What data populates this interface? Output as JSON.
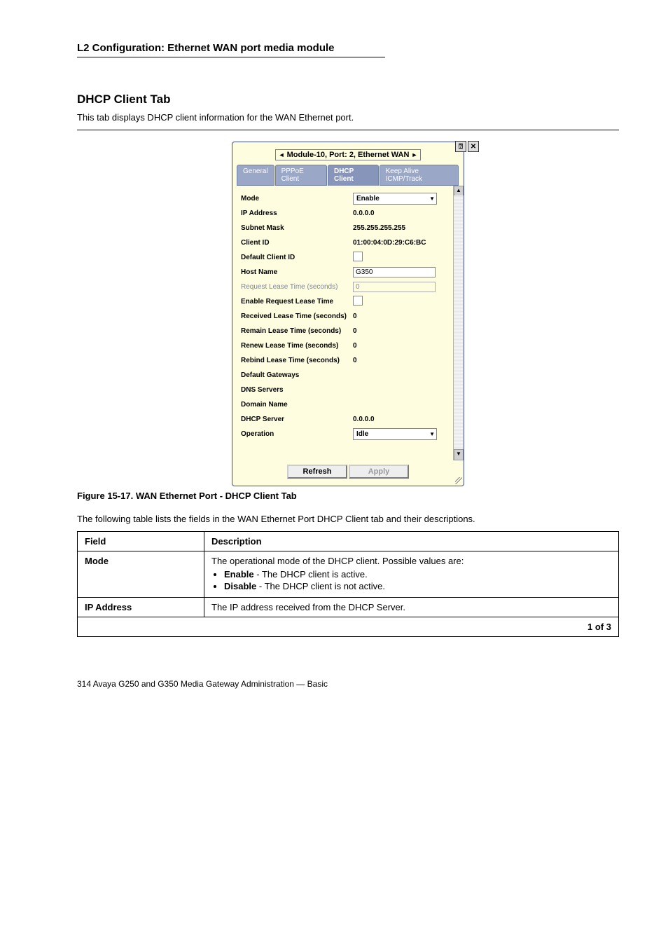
{
  "breadcrumb": "L2 Configuration: Ethernet WAN port media module",
  "section": {
    "title": "DHCP Client Tab",
    "desc": "This tab displays DHCP client information for the WAN Ethernet port."
  },
  "dialog": {
    "title_prefix_arrow": "◄",
    "title": "Module-10, Port: 2, Ethernet WAN",
    "title_suffix_arrow": "►",
    "tabs": [
      {
        "label": "General",
        "active": false
      },
      {
        "label": "PPPoE Client",
        "active": false
      },
      {
        "label": "DHCP Client",
        "active": true
      },
      {
        "label": "Keep Alive ICMP/Track",
        "active": false
      }
    ],
    "rows": [
      {
        "key": "mode",
        "label": "Mode",
        "control": "select",
        "value": "Enable"
      },
      {
        "key": "ip_address",
        "label": "IP Address",
        "control": "text",
        "value": "0.0.0.0"
      },
      {
        "key": "subnet_mask",
        "label": "Subnet Mask",
        "control": "text",
        "value": "255.255.255.255"
      },
      {
        "key": "client_id",
        "label": "Client ID",
        "control": "text",
        "value": "01:00:04:0D:29:C6:BC"
      },
      {
        "key": "default_client_id",
        "label": "Default Client ID",
        "control": "checkbox",
        "value": ""
      },
      {
        "key": "host_name",
        "label": "Host Name",
        "control": "input",
        "value": "G350"
      },
      {
        "key": "req_lease_time",
        "label": "Request Lease Time (seconds)",
        "control": "readonly",
        "value": "0",
        "dim": true
      },
      {
        "key": "enable_req_lease_time",
        "label": "Enable Request Lease Time",
        "control": "checkbox",
        "value": ""
      },
      {
        "key": "recv_lease_time",
        "label": "Received Lease Time (seconds)",
        "control": "text",
        "value": "0"
      },
      {
        "key": "remain_lease_time",
        "label": "Remain Lease Time (seconds)",
        "control": "text",
        "value": "0"
      },
      {
        "key": "renew_lease_time",
        "label": "Renew Lease Time (seconds)",
        "control": "text",
        "value": "0"
      },
      {
        "key": "rebind_lease_time",
        "label": "Rebind Lease Time (seconds)",
        "control": "text",
        "value": "0"
      },
      {
        "key": "default_gateways",
        "label": "Default Gateways",
        "control": "text",
        "value": ""
      },
      {
        "key": "dns_servers",
        "label": "DNS Servers",
        "control": "text",
        "value": ""
      },
      {
        "key": "domain_name",
        "label": "Domain Name",
        "control": "text",
        "value": ""
      },
      {
        "key": "dhcp_server",
        "label": "DHCP Server",
        "control": "text",
        "value": "0.0.0.0"
      },
      {
        "key": "operation",
        "label": "Operation",
        "control": "select",
        "value": "Idle"
      }
    ],
    "buttons": {
      "refresh": "Refresh",
      "apply": "Apply"
    }
  },
  "figure": {
    "caption_prefix": "Figure 15-17.",
    "caption": "WAN Ethernet Port - DHCP Client Tab"
  },
  "fields_intro": "The following table lists the fields in the WAN Ethernet Port DHCP Client tab and their descriptions.",
  "fields_table": {
    "headers": [
      "Field",
      "Description"
    ],
    "rows": [
      {
        "field": "Mode",
        "desc_lead": "The operational mode of the DHCP client. Possible values are:",
        "opts": [
          {
            "name": "Enable",
            "desc": " - The DHCP client is active."
          },
          {
            "name": "Disable",
            "desc": " - The DHCP client is not active."
          }
        ]
      },
      {
        "field": "IP Address",
        "desc_lead": "The IP address received from the DHCP Server."
      }
    ],
    "continues": "1 of 3"
  },
  "footer": {
    "left": "314 Avaya G250 and G350 Media Gateway Administration — Basic",
    "right": ""
  }
}
